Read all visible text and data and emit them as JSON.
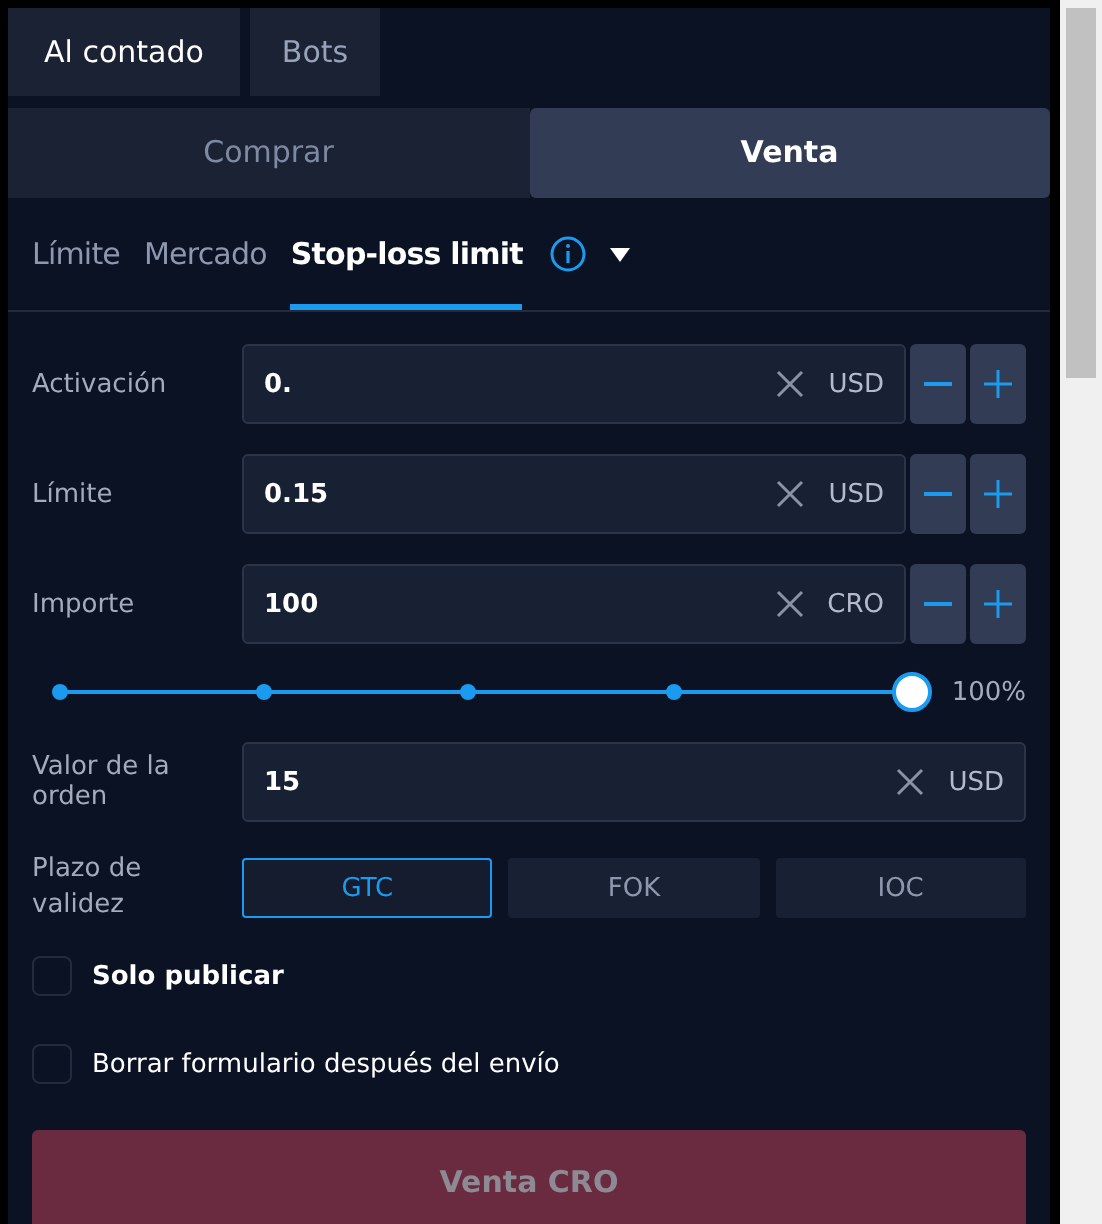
{
  "market_tabs": [
    {
      "label": "Al contado",
      "selected": true
    },
    {
      "label": "Bots",
      "selected": false
    }
  ],
  "side_tabs": [
    {
      "label": "Comprar",
      "selected": false
    },
    {
      "label": "Venta",
      "selected": true
    }
  ],
  "order_types": [
    {
      "label": "Límite",
      "selected": false
    },
    {
      "label": "Mercado",
      "selected": false
    },
    {
      "label": "Stop-loss limit",
      "selected": true
    }
  ],
  "fields": [
    {
      "label": "Activación",
      "value": "0.",
      "unit": "USD",
      "kind": "stepper"
    },
    {
      "label": "Límite",
      "value": "0.15",
      "unit": "USD",
      "kind": "stepper"
    },
    {
      "label": "Importe",
      "value": "100",
      "unit": "CRO",
      "kind": "stepper"
    }
  ],
  "amount_slider": {
    "level": 1,
    "reading": "100%"
  },
  "order_value": {
    "label": "Valor de la orden",
    "value": "15",
    "unit": "USD"
  },
  "time_in_force": {
    "label": "Plazo de validez",
    "options": [
      {
        "label": "GTC",
        "selected": true
      },
      {
        "label": "FOK",
        "selected": false
      },
      {
        "label": "IOC",
        "selected": false
      }
    ]
  },
  "checkboxes": [
    {
      "label": "Solo publicar",
      "checked": false,
      "bold": true
    },
    {
      "label": "Borrar formulario después del envío",
      "checked": false,
      "bold": false
    }
  ],
  "submit": {
    "label": "Venta CRO",
    "disabled": true
  }
}
